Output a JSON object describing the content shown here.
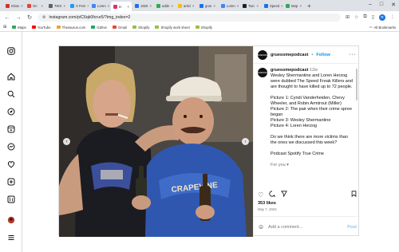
{
  "browser": {
    "tabs": [
      {
        "label": "Inbox",
        "color": "#d93025",
        "active": false
      },
      {
        "label": "Gn",
        "color": "#ea4335",
        "active": false
      },
      {
        "label": "TWX",
        "color": "#5f6368",
        "active": false
      },
      {
        "label": "X Fem",
        "color": "#1d9bf0",
        "active": false
      },
      {
        "label": "Loren",
        "color": "#4285f4",
        "active": false
      },
      {
        "label": "In",
        "color": "#e1306c",
        "active": true
      },
      {
        "label": "1920",
        "color": "#1a73e8",
        "active": false
      },
      {
        "label": "addn",
        "color": "#34a853",
        "active": false
      },
      {
        "label": "articl",
        "color": "#fbbc04",
        "active": false
      },
      {
        "label": "grus",
        "color": "#1a73e8",
        "active": false
      },
      {
        "label": "Loren",
        "color": "#4285f4",
        "active": false
      },
      {
        "label": "Two",
        "color": "#202124",
        "active": false
      },
      {
        "label": "Speed",
        "color": "#1a73e8",
        "active": false
      },
      {
        "label": "Map",
        "color": "#34a853",
        "active": false
      }
    ],
    "new_tab": "+",
    "url": "instagram.com/p/C6qk0fcrur5/?img_index=2",
    "profile_initial": "R",
    "bookmarks": [
      {
        "label": "Maps",
        "color": "#34a853"
      },
      {
        "label": "YouTube",
        "color": "#ff0000"
      },
      {
        "label": "Thesaurus.com",
        "color": "#f29d38"
      },
      {
        "label": "Gdrive",
        "color": "#1fa463"
      },
      {
        "label": "Gmail",
        "color": "#ea4335"
      },
      {
        "label": "Shopify",
        "color": "#95bf47"
      },
      {
        "label": "Shopify work sheet",
        "color": "#95bf47"
      },
      {
        "label": "Shopify",
        "color": "#95bf47"
      }
    ],
    "all_bookmarks": "All Bookmarks"
  },
  "post": {
    "username": "gruesomepodcast",
    "follow_label": "Follow",
    "separator": "•",
    "avatar_text": "GRUESOME",
    "caption_username": "gruesomepodcast",
    "caption_age": "12w",
    "caption_lines": [
      "Wesley Shermantine and Loren Herzog were dubbed The Speed Freak Killers and are thought to have killed up to 72 people.",
      "",
      "Picture 1: Cyndi Vanderheiden, Chevy Wheeler, and Robin Armtrout (Miller)",
      "Picture 2: The pair when their crime spree began",
      "Picture 3: Wesley Shermantine",
      "Picture 4: Loren Herzog",
      "",
      "Do we think there are more victims than the ones we discussed this week?",
      "",
      "Podcast Spotify True Crime",
      "",
      "For you ▾"
    ],
    "likes": "353 likes",
    "date": "May 7, 2024",
    "comment_placeholder": "Add a comment...",
    "post_label": "Post",
    "hat_text": "CRAPEVINE"
  }
}
